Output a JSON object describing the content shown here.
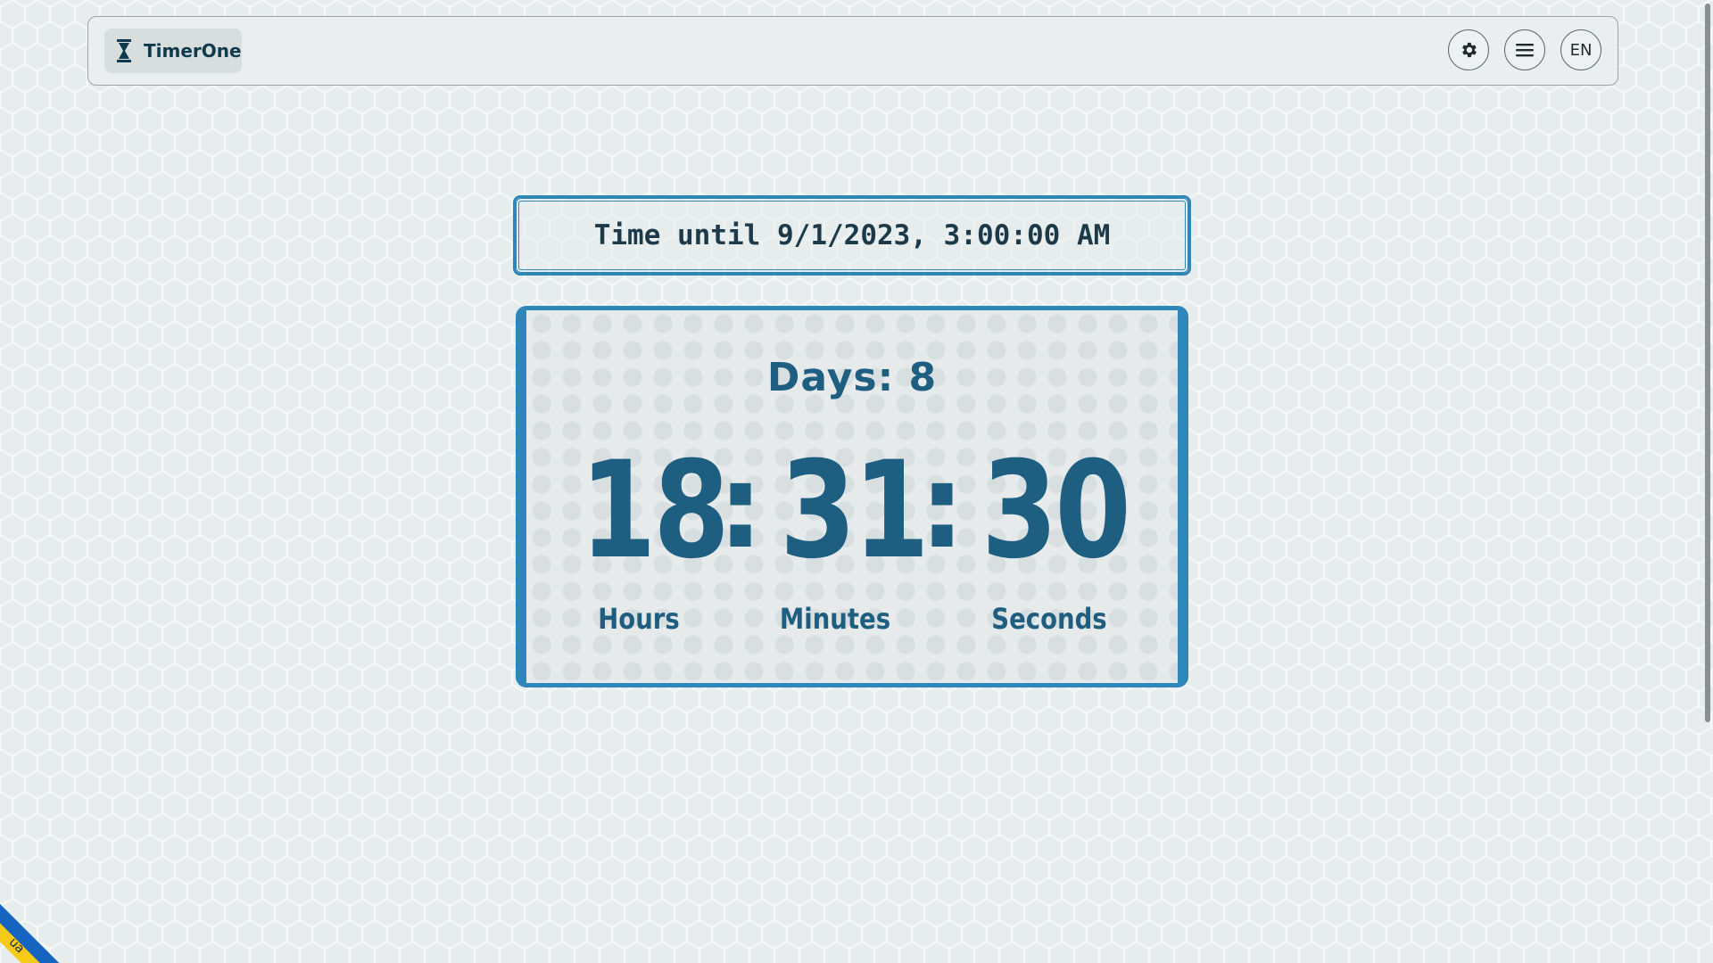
{
  "header": {
    "brand": "TimerOne",
    "settings_icon": "gear-icon",
    "menu_icon": "hamburger-menu-icon",
    "language": "EN"
  },
  "timer": {
    "target_label": "Time until 9/1/2023, 3:00:00 AM",
    "days_label": "Days: 8",
    "hours": "18",
    "minutes": "31",
    "seconds": "30",
    "separator": ":",
    "units": {
      "hours": "Hours",
      "minutes": "Minutes",
      "seconds": "Seconds"
    }
  },
  "ribbon": {
    "label": "ua",
    "colors": [
      "#1565c0",
      "#f7ca18"
    ]
  },
  "colors": {
    "accent": "#2f86b8",
    "text_primary": "#1e5e80"
  }
}
